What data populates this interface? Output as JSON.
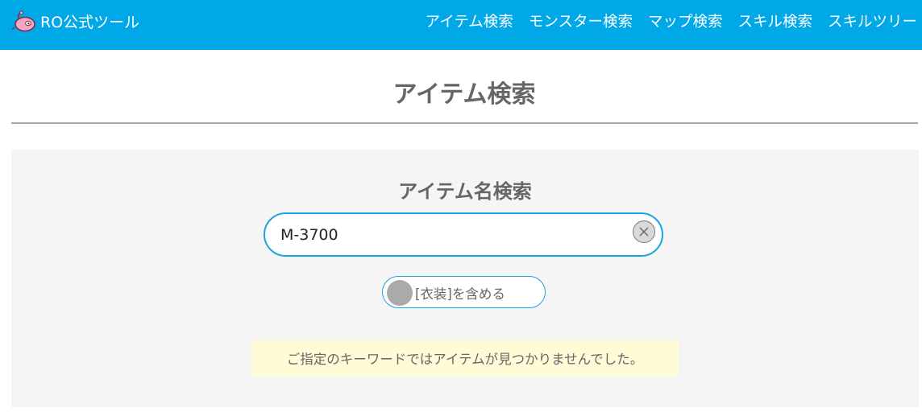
{
  "header": {
    "brand_label": "RO公式ツール",
    "nav": [
      {
        "label": "アイテム検索"
      },
      {
        "label": "モンスター検索"
      },
      {
        "label": "マップ検索"
      },
      {
        "label": "スキル検索"
      },
      {
        "label": "スキルツリー"
      }
    ]
  },
  "main": {
    "title": "アイテム検索",
    "search_section": {
      "title": "アイテム名検索",
      "input_value": "M-3700",
      "toggle_label": "[衣装]を含める",
      "toggle_on": false,
      "notice": "ご指定のキーワードではアイテムが見つかりませんでした。"
    }
  },
  "icons": {
    "brand": "poring-logo-icon",
    "clear": "close-icon"
  },
  "colors": {
    "header_bg": "#00a8e8",
    "accent_border": "#1aa5e0",
    "notice_bg": "#fffbd6",
    "panel_bg": "#f5f5f5"
  }
}
